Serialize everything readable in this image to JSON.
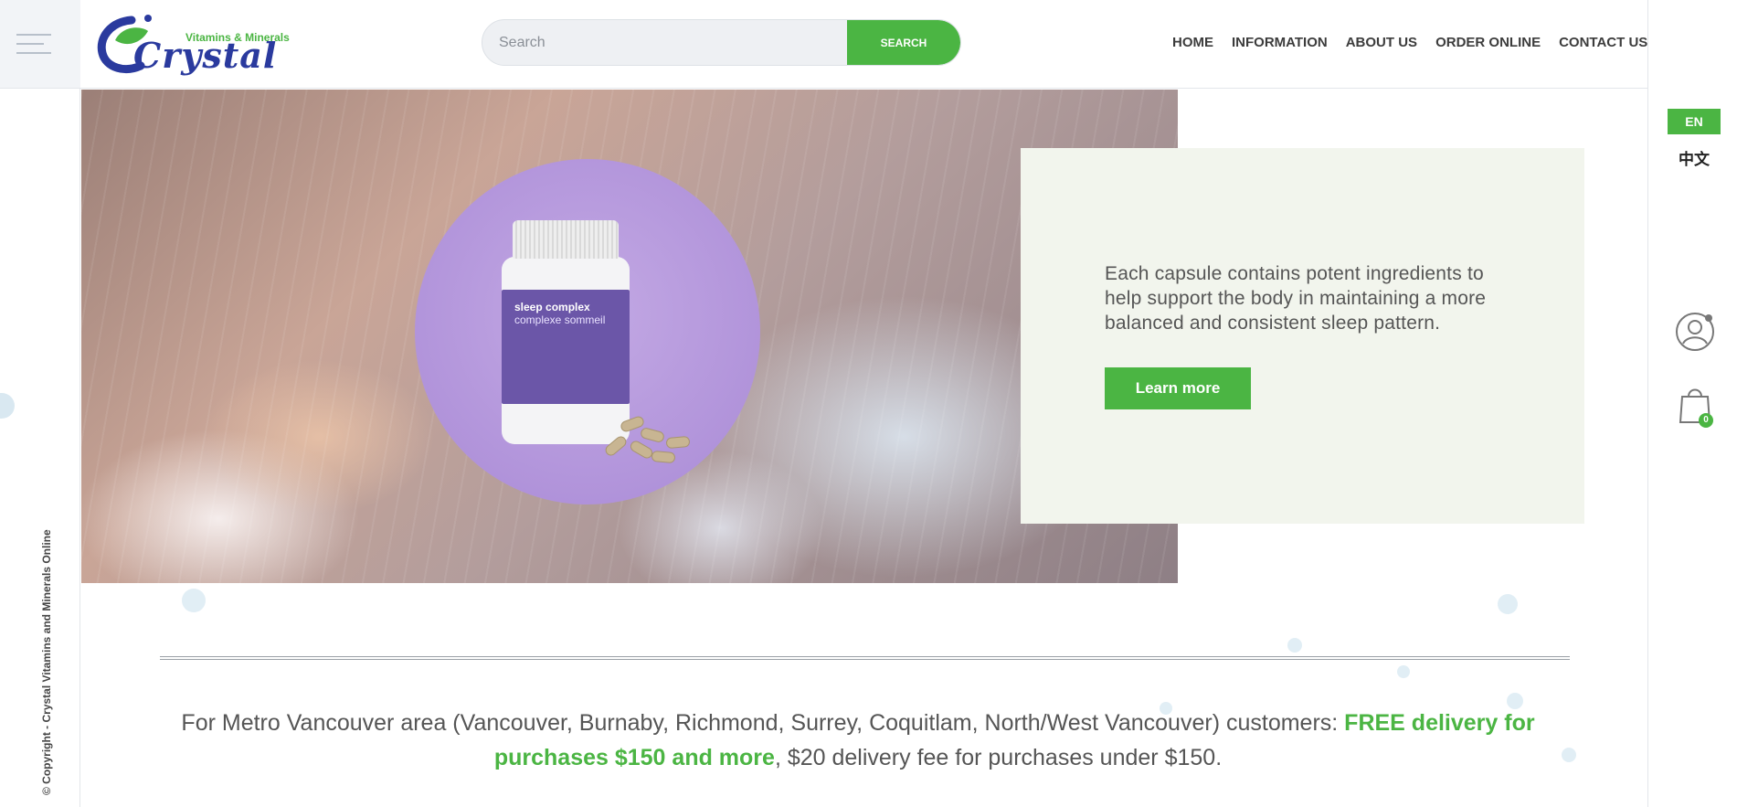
{
  "brand": {
    "name": "Crystal",
    "tagline": "Vitamins & Minerals"
  },
  "search": {
    "placeholder": "Search",
    "value": "",
    "button_label": "SEARCH"
  },
  "nav": {
    "items": [
      {
        "label": "HOME"
      },
      {
        "label": "INFORMATION"
      },
      {
        "label": "ABOUT US"
      },
      {
        "label": "ORDER ONLINE"
      },
      {
        "label": "CONTACT US"
      }
    ]
  },
  "language": {
    "active": "EN",
    "alternate": "中文"
  },
  "cart": {
    "count": "0"
  },
  "hero": {
    "product_name": "sleep complex",
    "product_name_fr": "complexe sommeil",
    "description": "Each capsule contains potent ingredients to help support the body in maintaining a more balanced and consistent sleep pattern.",
    "cta_label": "Learn more"
  },
  "delivery": {
    "prefix": "For Metro Vancouver area (Vancouver, Burnaby, Richmond, Surrey, Coquitlam, North/West Vancouver) customers: ",
    "highlight": "FREE delivery for purchases $150 and more",
    "suffix": ", $20 delivery fee for purchases under $150."
  },
  "footer": {
    "copyright": "© Copyright - Crystal Vitamins and Minerals Online"
  },
  "colors": {
    "accent": "#4bb543",
    "brand_blue": "#2a3a9e",
    "card_bg": "#f2f5ed",
    "product_purple": "#a98ad6"
  },
  "icons": [
    "menu-icon",
    "user-icon",
    "shopping-bag-icon"
  ]
}
